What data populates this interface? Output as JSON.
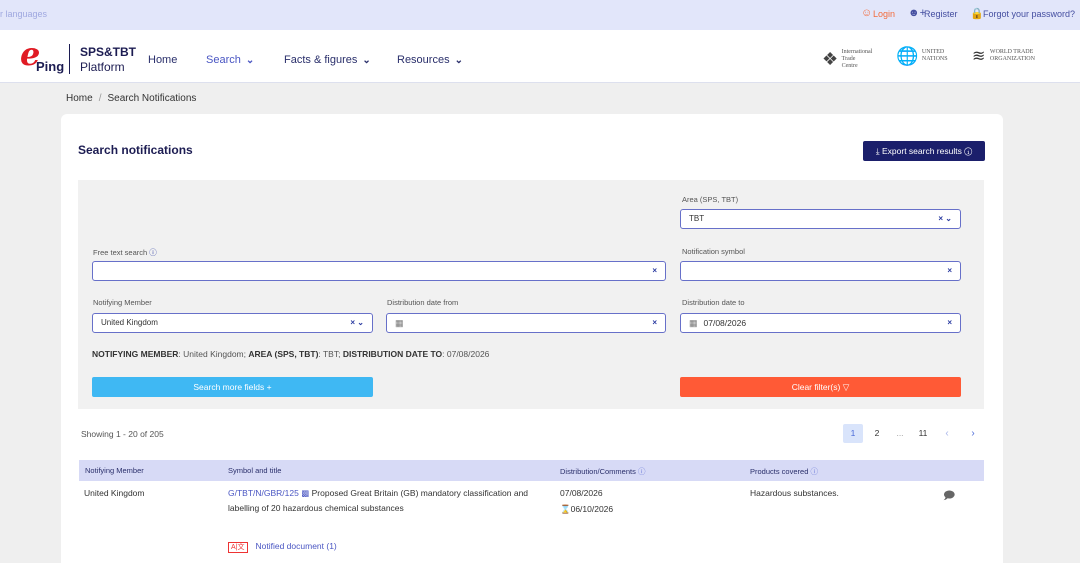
{
  "topbar": {
    "languages": "r languages",
    "login": "Login",
    "register": "Register",
    "forgot": "Forgot your password?"
  },
  "header": {
    "logo_ping": "Ping",
    "logo_title1": "SPS&TBT",
    "logo_title2": "Platform",
    "nav": {
      "home": "Home",
      "search": "Search",
      "facts": "Facts & figures",
      "resources": "Resources"
    },
    "partners": {
      "itc": [
        "International",
        "Trade",
        "Centre"
      ],
      "un": [
        "UNITED",
        "NATIONS"
      ],
      "wto": [
        "WORLD TRADE",
        "ORGANIZATION"
      ]
    }
  },
  "breadcrumb": {
    "home": "Home",
    "sep": "/",
    "current": "Search Notifications"
  },
  "main": {
    "title": "Search notifications",
    "export_label": "Export search results"
  },
  "filters": {
    "area_label": "Area (SPS, TBT)",
    "area_value": "TBT",
    "free_text_label": "Free text search",
    "free_text_value": "",
    "notification_symbol_label": "Notification symbol",
    "notification_symbol_value": "",
    "notifying_member_label": "Notifying Member",
    "notifying_member_value": "United Kingdom",
    "date_from_label": "Distribution date from",
    "date_from_value": "",
    "date_to_label": "Distribution date to",
    "date_to_value": "07/08/2026",
    "summary": {
      "k1": "NOTIFYING MEMBER",
      "v1": ": United Kingdom; ",
      "k2": "AREA (SPS, TBT)",
      "v2": ": TBT; ",
      "k3": "DISTRIBUTION DATE TO",
      "v3": ": 07/08/2026"
    },
    "more_label": "Search more fields",
    "clear_label": "Clear filter(s)"
  },
  "results": {
    "showing": "Showing 1 - 20 of 205",
    "pages": [
      "1",
      "2",
      "...",
      "11"
    ],
    "current_page": "1",
    "columns": [
      "Notifying Member",
      "Symbol and title",
      "Distribution/Comments",
      "Products covered"
    ],
    "rows": [
      {
        "member": "United Kingdom",
        "symbol": "G/TBT/N/GBR/125",
        "title_line1": "Proposed Great Britain (GB) mandatory classification and",
        "title_line2": "labelling of 20 hazardous chemical substances",
        "distribution": "07/08/2026",
        "comments": "06/10/2026",
        "products": "Hazardous substances.",
        "doc_badge": "A|文",
        "notified_doc": "Notified document (1)"
      }
    ]
  },
  "colors": {
    "accent": "#1b1f6b",
    "link": "#4a56c3",
    "primary_btn": "#3fb8f3",
    "danger_btn": "#ff5a36",
    "brand_red": "#e01b24"
  }
}
